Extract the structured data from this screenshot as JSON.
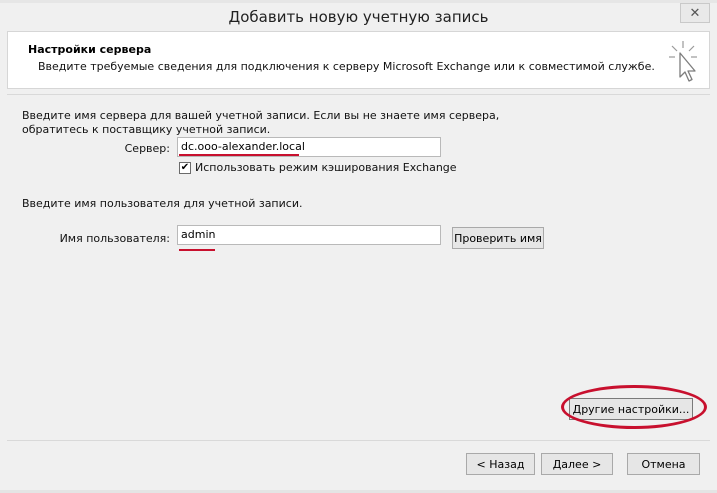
{
  "window": {
    "title": "Добавить новую учетную запись",
    "close_glyph": "✕"
  },
  "header": {
    "title": "Настройки сервера",
    "subtitle": "Введите требуемые сведения для подключения к серверу Microsoft Exchange или к совместимой службе."
  },
  "server_section": {
    "instructions_line1": "Введите имя сервера для вашей учетной записи. Если вы не знаете имя сервера,",
    "instructions_line2": "обратитесь к поставщику учетной записи.",
    "server_label": "Сервер:",
    "server_value": "dc.ooo-alexander.local",
    "cache_checkbox_label": "Использовать режим кэширования Exchange",
    "cache_checked": true,
    "checkmark": "✔"
  },
  "user_section": {
    "instructions": "Введите имя пользователя для учетной записи.",
    "username_label": "Имя пользователя:",
    "username_value": "admin",
    "check_name_button": "Проверить имя"
  },
  "more_settings_button": "Другие настройки...",
  "footer": {
    "back_button": "< Назад",
    "next_button": "Далее >",
    "cancel_button": "Отмена"
  },
  "colors": {
    "annotation_red": "#c8102e",
    "dialog_bg": "#f0f0f0"
  },
  "icons": {
    "header_icon": "cursor-click-icon"
  }
}
